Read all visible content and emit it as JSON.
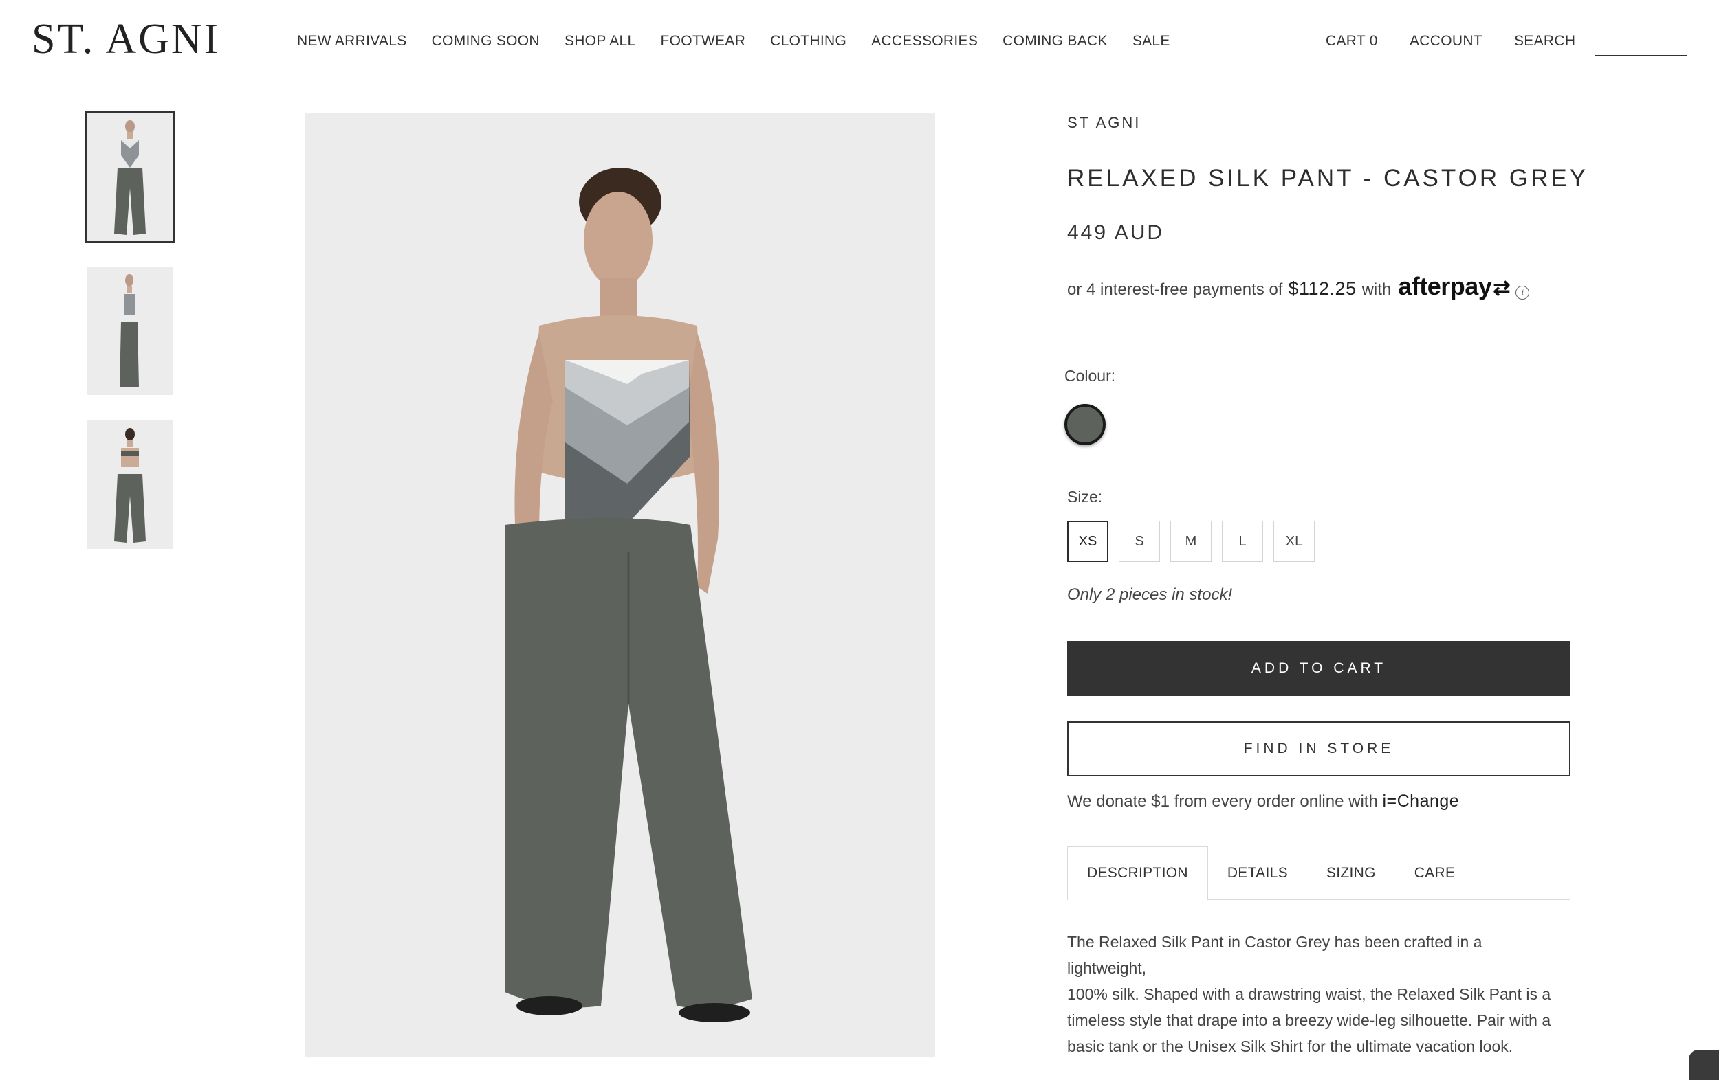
{
  "header": {
    "logo": "ST. AGNI",
    "nav": [
      "NEW ARRIVALS",
      "COMING SOON",
      "SHOP ALL",
      "FOOTWEAR",
      "CLOTHING",
      "ACCESSORIES",
      "COMING BACK",
      "SALE"
    ],
    "cart": "CART 0",
    "account": "ACCOUNT",
    "search": "SEARCH"
  },
  "product": {
    "brand": "ST AGNI",
    "title": "RELAXED SILK PANT - CASTOR GREY",
    "price": "449 AUD",
    "afterpay": {
      "prefix": "or 4 interest-free payments of",
      "amount": "$112.25",
      "with": "with",
      "brand": "afterpay",
      "info_icon": "info-icon"
    },
    "colour_label": "Colour:",
    "colour_swatch": "#5d625c",
    "size_label": "Size:",
    "sizes": [
      "XS",
      "S",
      "M",
      "L",
      "XL"
    ],
    "selected_size": "XS",
    "stock": "Only 2 pieces in stock!",
    "add_to_cart": "ADD TO CART",
    "find_in_store": "FIND IN STORE",
    "donate_prefix": "We donate $1 from every order online with",
    "donate_link": "i=Change",
    "tabs": [
      "DESCRIPTION",
      "DETAILS",
      "SIZING",
      "CARE"
    ],
    "active_tab": "DESCRIPTION",
    "description_lines": [
      "The Relaxed Silk Pant in Castor Grey has been crafted in a lightweight,",
      "100% silk. Shaped with a drawstring waist, the Relaxed Silk Pant is a",
      "timeless style that drape into a breezy wide-leg silhouette. Pair with a",
      "basic tank or the Unisex Silk Shirt for the ultimate vacation look."
    ]
  },
  "colors": {
    "button_dark": "#333333",
    "pant_grey": "#5d625c",
    "image_bg": "#ececec"
  }
}
